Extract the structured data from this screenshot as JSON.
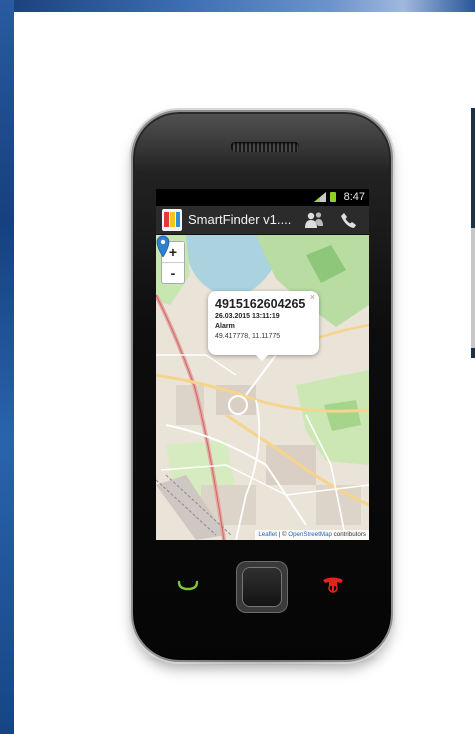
{
  "status_bar": {
    "time": "8:47"
  },
  "app": {
    "title": "SmartFinder v1...."
  },
  "map": {
    "zoom_in": "+",
    "zoom_out": "-",
    "popup": {
      "phone_number": "4915162604265",
      "datetime": "26.03.2015 13:11:19",
      "event": "Alarm",
      "coordinates": "49.417778, 11.11775",
      "close": "×"
    },
    "attribution": {
      "leaflet": "Leaflet",
      "separator": " | © ",
      "osm": "OpenStreetMap",
      "suffix": " contributors"
    }
  },
  "colors": {
    "call_green": "#7ec63a",
    "end_red": "#e2231a",
    "marker_blue": "#2f7fd0",
    "battery_green": "#8fcf2a"
  },
  "icons": [
    "app-icon",
    "signal-icon",
    "battery-icon",
    "contacts-icon",
    "phone-icon",
    "map-marker-icon",
    "call-button-icon",
    "end-call-button-icon"
  ]
}
